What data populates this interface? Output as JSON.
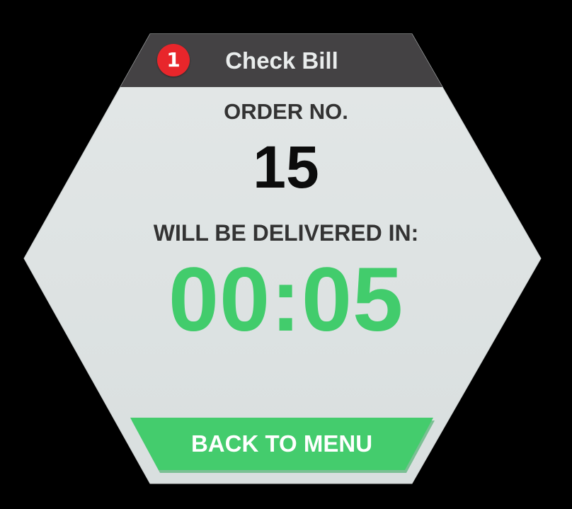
{
  "header": {
    "badge_count": "1",
    "title": "Check Bill"
  },
  "order": {
    "label": "ORDER NO.",
    "number": "15"
  },
  "delivery": {
    "label": "WILL BE DELIVERED IN:",
    "timer": "00:05"
  },
  "actions": {
    "back_label": "BACK TO MENU"
  },
  "colors": {
    "background": "#000000",
    "panel": "#dde2e2",
    "header": "#444244",
    "badge": "#e8262b",
    "accent_green": "#42cc6c",
    "text_dark": "#333333"
  }
}
